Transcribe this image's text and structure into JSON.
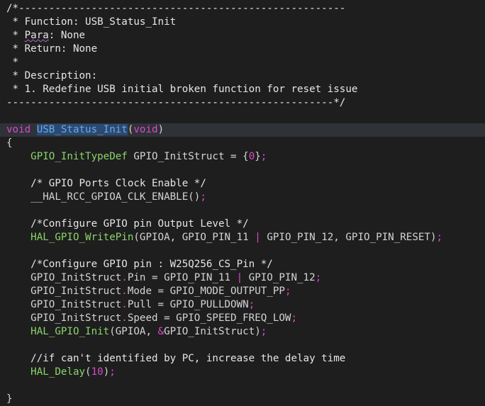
{
  "editor": {
    "lines": [
      [
        {
          "t": "/*------------------------------------------------------",
          "c": "comment"
        }
      ],
      [
        {
          "t": " * Function: USB_Status_Init",
          "c": "comment"
        }
      ],
      [
        {
          "t": " * ",
          "c": "comment"
        },
        {
          "t": "Para",
          "c": "comment",
          "squiggle": true
        },
        {
          "t": ": None",
          "c": "comment"
        }
      ],
      [
        {
          "t": " * Return: None",
          "c": "comment"
        }
      ],
      [
        {
          "t": " *",
          "c": "comment"
        }
      ],
      [
        {
          "t": " * Description:",
          "c": "comment"
        }
      ],
      [
        {
          "t": " * 1. Redefine USB initial broken function for reset issue",
          "c": "comment"
        }
      ],
      [
        {
          "t": "------------------------------------------------------*/",
          "c": "comment"
        }
      ],
      [],
      [
        {
          "t": "void",
          "c": "keyword"
        },
        {
          "t": " ",
          "c": "punct"
        },
        {
          "t": "USB_Status_Init",
          "c": "func-hl"
        },
        {
          "t": "(",
          "c": "punct"
        },
        {
          "t": "void",
          "c": "keyword"
        },
        {
          "t": ")",
          "c": "punct"
        }
      ],
      [
        {
          "t": "{",
          "c": "punct"
        }
      ],
      [
        {
          "t": "    ",
          "c": "punct"
        },
        {
          "t": "GPIO_InitTypeDef",
          "c": "type"
        },
        {
          "t": " GPIO_InitStruct = {",
          "c": "ident"
        },
        {
          "t": "0",
          "c": "num"
        },
        {
          "t": "}",
          "c": "punct"
        },
        {
          "t": ";",
          "c": "semi"
        }
      ],
      [],
      [
        {
          "t": "    /* GPIO Ports Clock Enable */",
          "c": "comment"
        }
      ],
      [
        {
          "t": "    __HAL_RCC_GPIOA_CLK_ENABLE",
          "c": "ident"
        },
        {
          "t": "()",
          "c": "punct"
        },
        {
          "t": ";",
          "c": "semi"
        }
      ],
      [],
      [
        {
          "t": "    /*Configure GPIO pin Output Level */",
          "c": "comment"
        }
      ],
      [
        {
          "t": "    ",
          "c": "punct"
        },
        {
          "t": "HAL_GPIO_WritePin",
          "c": "func"
        },
        {
          "t": "(GPIOA, GPIO_PIN_11 ",
          "c": "ident"
        },
        {
          "t": "|",
          "c": "op"
        },
        {
          "t": " GPIO_PIN_12, GPIO_PIN_RESET)",
          "c": "ident"
        },
        {
          "t": ";",
          "c": "semi"
        }
      ],
      [],
      [
        {
          "t": "    /*Configure GPIO pin : W25Q256_CS_Pin */",
          "c": "comment"
        }
      ],
      [
        {
          "t": "    GPIO_InitStruct",
          "c": "ident"
        },
        {
          "t": ".",
          "c": "dot"
        },
        {
          "t": "Pin",
          "c": "member"
        },
        {
          "t": " = GPIO_PIN_11 ",
          "c": "ident"
        },
        {
          "t": "|",
          "c": "op"
        },
        {
          "t": " GPIO_PIN_12",
          "c": "ident"
        },
        {
          "t": ";",
          "c": "semi"
        }
      ],
      [
        {
          "t": "    GPIO_InitStruct",
          "c": "ident"
        },
        {
          "t": ".",
          "c": "dot"
        },
        {
          "t": "Mode",
          "c": "member"
        },
        {
          "t": " = GPIO_MODE_OUTPUT_PP",
          "c": "ident"
        },
        {
          "t": ";",
          "c": "semi"
        }
      ],
      [
        {
          "t": "    GPIO_InitStruct",
          "c": "ident"
        },
        {
          "t": ".",
          "c": "dot"
        },
        {
          "t": "Pull",
          "c": "member"
        },
        {
          "t": " = GPIO_PULLDOWN",
          "c": "ident"
        },
        {
          "t": ";",
          "c": "semi"
        }
      ],
      [
        {
          "t": "    GPIO_InitStruct",
          "c": "ident"
        },
        {
          "t": ".",
          "c": "dot"
        },
        {
          "t": "Speed",
          "c": "member"
        },
        {
          "t": " = GPIO_SPEED_FREQ_LOW",
          "c": "ident"
        },
        {
          "t": ";",
          "c": "semi"
        }
      ],
      [
        {
          "t": "    ",
          "c": "punct"
        },
        {
          "t": "HAL_GPIO_Init",
          "c": "func"
        },
        {
          "t": "(GPIOA, ",
          "c": "ident"
        },
        {
          "t": "&",
          "c": "op"
        },
        {
          "t": "GPIO_InitStruct)",
          "c": "ident"
        },
        {
          "t": ";",
          "c": "semi"
        }
      ],
      [],
      [
        {
          "t": "    //if can't identified by PC, increase the delay time",
          "c": "comment"
        }
      ],
      [
        {
          "t": "    ",
          "c": "punct"
        },
        {
          "t": "HAL_Delay",
          "c": "func"
        },
        {
          "t": "(",
          "c": "punct"
        },
        {
          "t": "10",
          "c": "num"
        },
        {
          "t": ")",
          "c": "punct"
        },
        {
          "t": ";",
          "c": "semi"
        }
      ],
      [],
      [
        {
          "t": "}",
          "c": "punct"
        }
      ]
    ],
    "current_line": 9
  }
}
